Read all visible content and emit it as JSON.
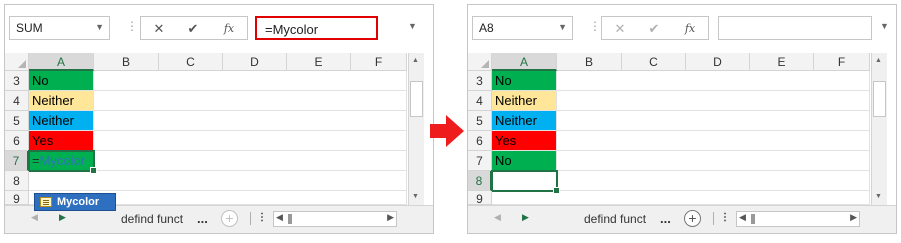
{
  "columns": [
    "A",
    "B",
    "C",
    "D",
    "E",
    "F"
  ],
  "left": {
    "name_box": "SUM",
    "formula": "=Mycolor",
    "formula_buttons": {
      "cancel": "✕",
      "enter": "✔",
      "fx": "fx"
    },
    "rows": [
      {
        "num": "3",
        "value": "No",
        "color": "#00b050"
      },
      {
        "num": "4",
        "value": "Neither",
        "color": "#ffe699"
      },
      {
        "num": "5",
        "value": "Neither",
        "color": "#00b0f0"
      },
      {
        "num": "6",
        "value": "Yes",
        "color": "#ff0000"
      },
      {
        "num": "7",
        "value_prefix": "=",
        "value_func": "Mycolor",
        "color": "#00b050"
      },
      {
        "num": "8",
        "value": "",
        "color": ""
      },
      {
        "num": "9",
        "value": "",
        "color": ""
      }
    ],
    "autocomplete": "Mycolor",
    "sheet_tab": "defind funct",
    "tab_more": "...",
    "add_sheet": "⊕"
  },
  "right": {
    "name_box": "A8",
    "formula": "",
    "formula_buttons": {
      "cancel": "✕",
      "enter": "✔",
      "fx": "fx"
    },
    "rows": [
      {
        "num": "3",
        "value": "No",
        "color": "#00b050"
      },
      {
        "num": "4",
        "value": "Neither",
        "color": "#ffe699"
      },
      {
        "num": "5",
        "value": "Neither",
        "color": "#00b0f0"
      },
      {
        "num": "6",
        "value": "Yes",
        "color": "#ff0000"
      },
      {
        "num": "7",
        "value": "No",
        "color": "#00b050"
      },
      {
        "num": "8",
        "value": "",
        "color": ""
      },
      {
        "num": "9",
        "value": "",
        "color": ""
      }
    ],
    "sheet_tab": "defind funct",
    "tab_more": "...",
    "add_sheet": "⊕"
  },
  "colors": {
    "excel_green": "#217346",
    "highlight_red": "#e00000",
    "autocomplete_blue": "#2f6fc0",
    "arrow_red": "#ee1c1c"
  }
}
